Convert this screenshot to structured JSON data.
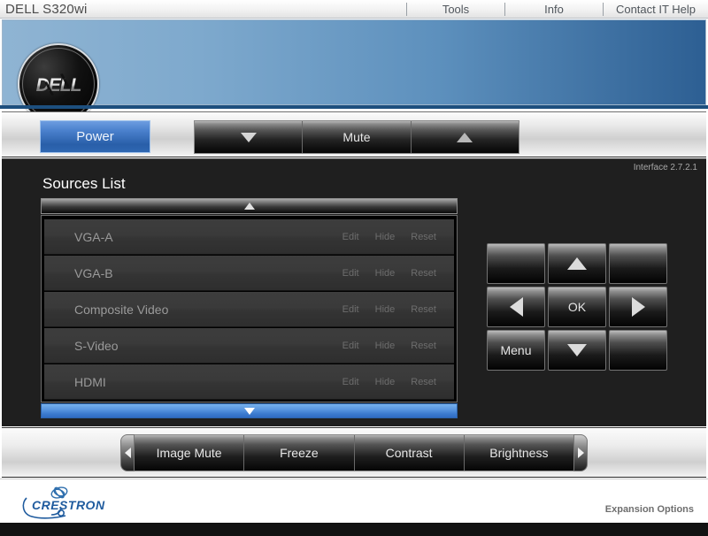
{
  "topbar": {
    "title": "DELL S320wi",
    "menu": [
      {
        "label": "Tools",
        "name": "menu-tools"
      },
      {
        "label": "Info",
        "name": "menu-info"
      },
      {
        "label": "Contact IT Help",
        "name": "menu-contact-it-help"
      }
    ]
  },
  "banner": {
    "logo_text": "DELL"
  },
  "controls": {
    "power_label": "Power",
    "volume_down_icon": "triangle-down-icon",
    "mute_label": "Mute",
    "volume_up_icon": "triangle-up-icon"
  },
  "main": {
    "interface_version": "Interface 2.7.2.1",
    "sources_title": "Sources List",
    "scroll_up_icon": "triangle-up-icon",
    "scroll_down_icon": "triangle-down-icon",
    "actions": {
      "edit": "Edit",
      "hide": "Hide",
      "reset": "Reset"
    },
    "sources": [
      {
        "name": "VGA-A"
      },
      {
        "name": "VGA-B"
      },
      {
        "name": "Composite Video"
      },
      {
        "name": "S-Video"
      },
      {
        "name": "HDMI"
      }
    ]
  },
  "dpad": {
    "keys": [
      {
        "label": "",
        "icon": "",
        "name": "pad-blank-top-left"
      },
      {
        "label": "",
        "icon": "triangle-up-icon",
        "name": "pad-up"
      },
      {
        "label": "",
        "icon": "",
        "name": "pad-blank-top-right"
      },
      {
        "label": "",
        "icon": "triangle-left-icon",
        "name": "pad-left"
      },
      {
        "label": "OK",
        "icon": "",
        "name": "pad-ok"
      },
      {
        "label": "",
        "icon": "triangle-right-icon",
        "name": "pad-right"
      },
      {
        "label": "Menu",
        "icon": "",
        "name": "pad-menu"
      },
      {
        "label": "",
        "icon": "triangle-down-icon",
        "name": "pad-down"
      },
      {
        "label": "",
        "icon": "",
        "name": "pad-blank-bottom-right"
      }
    ]
  },
  "toolbar": {
    "prev_icon": "triangle-left-icon",
    "next_icon": "triangle-right-icon",
    "tabs": [
      {
        "label": "Image Mute"
      },
      {
        "label": "Freeze"
      },
      {
        "label": "Contrast"
      },
      {
        "label": "Brightness"
      }
    ]
  },
  "footer": {
    "brand": "CRESTRON",
    "expansion_label": "Expansion Options"
  },
  "colors": {
    "accent_blue": "#3a79cd",
    "banner_blue_left": "#8fb4d3",
    "banner_blue_right": "#2d5f93",
    "panel_dark": "#1f1f1f",
    "crestron_blue": "#1f5b9e"
  }
}
